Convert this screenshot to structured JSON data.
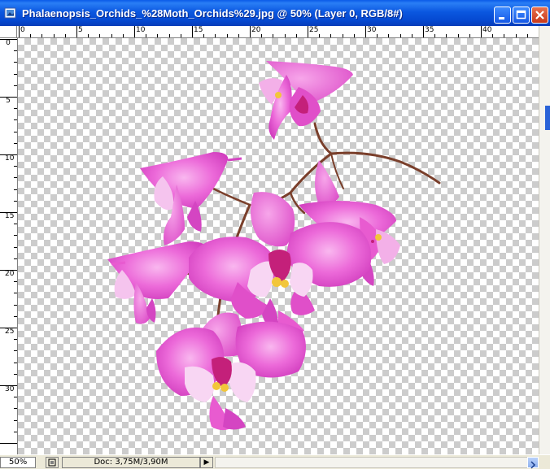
{
  "window": {
    "title": "Phalaenopsis_Orchids_%28Moth_Orchids%29.jpg @ 50% (Layer 0, RGB/8#)",
    "icons": {
      "app": "photoshop-document-icon",
      "minimize": "minimize-icon",
      "maximize": "maximize-icon",
      "close": "close-icon"
    }
  },
  "rulers": {
    "horizontal": [
      "0",
      "5",
      "10",
      "15",
      "20",
      "25",
      "30",
      "35",
      "40"
    ],
    "vertical": [
      "0",
      "5",
      "10",
      "15",
      "20",
      "25",
      "30"
    ]
  },
  "status": {
    "zoom": "50%",
    "doc_info": "Doc: 3,75M/3,90M",
    "menu_arrow": "▶"
  },
  "colors": {
    "titlebar": "#0b58e0",
    "petal": "#e85bd0",
    "petal_light": "#f59fe6",
    "stem": "#7a3f2b",
    "lip_yellow": "#f2c63a"
  }
}
